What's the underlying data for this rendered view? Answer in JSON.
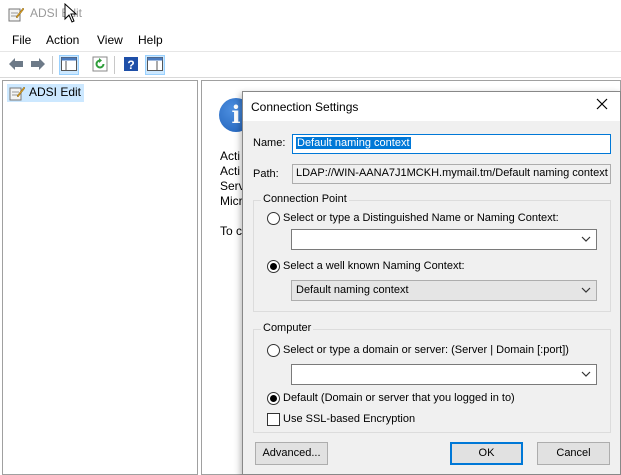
{
  "app": {
    "title": "ADSI Edit"
  },
  "menu": [
    "File",
    "Action",
    "View",
    "Help"
  ],
  "tree": {
    "root_label": "ADSI Edit"
  },
  "main_pane": {
    "lines": [
      "Acti",
      "Acti",
      "Serv",
      "Micr",
      "To c"
    ]
  },
  "dialog": {
    "title": "Connection Settings",
    "name_label": "Name:",
    "name_value": "Default naming context",
    "path_label": "Path:",
    "path_value": "LDAP://WIN-AANA7J1MCKH.mymail.tm/Default naming context",
    "connection_point": {
      "title": "Connection Point",
      "option_dn_label": "Select or type a Distinguished Name or Naming Context:",
      "option_dn_value": "",
      "option_known_label": "Select a well known Naming Context:",
      "option_known_value": "Default naming context",
      "selected": "known"
    },
    "computer": {
      "title": "Computer",
      "option_server_label": "Select or type a domain or server: (Server | Domain [:port])",
      "option_server_value": "",
      "option_default_label": "Default (Domain or server that you logged in to)",
      "selected": "default",
      "ssl_label": "Use SSL-based Encryption",
      "ssl_checked": false
    },
    "buttons": {
      "advanced": "Advanced...",
      "ok": "OK",
      "cancel": "Cancel"
    }
  },
  "colors": {
    "selection": "#0078d7",
    "tree_highlight": "#cce8ff",
    "dialog_bg": "#f0f0f0"
  },
  "icons": [
    "adsi-edit-icon",
    "back-arrow-icon",
    "forward-arrow-icon",
    "console-tree-icon",
    "refresh-icon",
    "help-icon",
    "action-pane-icon",
    "info-icon",
    "close-icon",
    "chevron-down-icon"
  ]
}
